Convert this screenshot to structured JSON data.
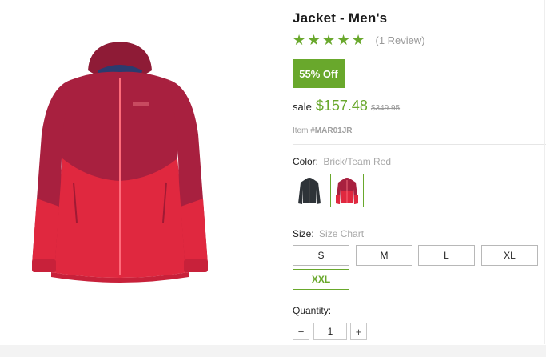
{
  "product": {
    "title": "Jacket - Men's",
    "rating": 5,
    "rating_max": 5,
    "review_text": "(1 Review)",
    "discount_badge": "55% Off",
    "sale_label": "sale",
    "sale_price": "$157.48",
    "original_price": "$349.95",
    "item_label": "Item #",
    "item_number": "MAR01JR",
    "image_icon": "red-jacket-image"
  },
  "color": {
    "label": "Color:",
    "selected": "Brick/Team Red",
    "swatches": [
      {
        "name": "black-jacket-swatch",
        "color": "#2e3338",
        "selected": false
      },
      {
        "name": "red-jacket-swatch",
        "color": "#d42a45",
        "selected": true
      }
    ]
  },
  "size": {
    "label": "Size:",
    "chart_link": "Size Chart",
    "options": [
      "S",
      "M",
      "L",
      "XL",
      "XXL"
    ],
    "selected": "XXL"
  },
  "quantity": {
    "label": "Quantity:",
    "value": "1",
    "minus": "−",
    "plus": "+"
  },
  "colors": {
    "accent": "#69a82c",
    "jacket_upper": "#a8203f",
    "jacket_lower": "#e0283f"
  }
}
